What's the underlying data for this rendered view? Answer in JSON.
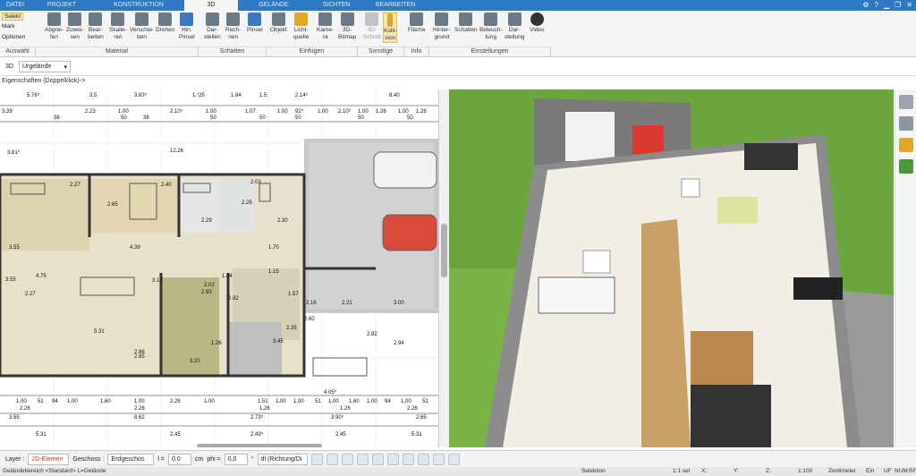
{
  "tabs": [
    "DATEI",
    "PROJEKT",
    "KONSTRUKTION",
    "3D",
    "GELÄNDE",
    "SICHTEN",
    "BEARBEITEN"
  ],
  "active_tab": "3D",
  "ribbon": {
    "selekt": "Selekt",
    "mark": "Mark",
    "optionen": "Optionen",
    "abgreifen": "Abgrei-\nfen",
    "zuweisen": "Zuwei-\nsen",
    "bearbeiten": "Bear-\nbeiten",
    "skalieren": "Skalie-\nren",
    "verschieben": "Verschie-\nben",
    "drehen": "Drehen",
    "hinpinsel": "Hin.\nPinsel",
    "darstellen": "Dar-\nstellen",
    "rechnen": "Rech-\nnen",
    "pinsel": "Pinsel",
    "objekt": "Objekt",
    "lichtquelle": "Licht-\nquelle",
    "kamera": "Kame-\nra",
    "bitmap3d": "3D-\nBitmap",
    "schnitt3d": "3D-\nSchnitt",
    "kollision": "Kolli-\nsion",
    "flaeche": "Fläche",
    "hintergrund": "Hinter-\ngrund",
    "schatten": "Schatten",
    "beleuchtung": "Beleuch-\ntung",
    "darstellung": "Dar-\nstellung",
    "video": "Video",
    "groups": {
      "auswahl": "Auswahl",
      "material": "Material",
      "schatten": "Schatten",
      "einfuegen": "Einfügen",
      "sonstige": "Sonstige",
      "info": "Info",
      "einstellungen": "Einstellungen"
    }
  },
  "subbar": {
    "label": "3D",
    "value": "Urgelände"
  },
  "hint": "Eigenschaften (Doppelklick)->",
  "plan": {
    "top_dims": [
      "5.76⁵",
      "3.5",
      "3.83⁵",
      "1.⁷25",
      "1.84",
      "1.5",
      "2.14⁵",
      "8.40"
    ],
    "sub_dims": [
      "3.39",
      "2.23",
      "1.00",
      "2.10⁵",
      "1.00",
      "1.07",
      "1.00",
      "92⁵",
      "1.00",
      "2.10⁵",
      "1.00",
      "1.26",
      "1.00",
      "1.26"
    ],
    "sub_dims2": [
      "38",
      "50",
      "38",
      "50",
      "50",
      "50",
      "50",
      "50"
    ],
    "left_dims": [
      "3.81⁵",
      "12.26",
      "3.55",
      "2.27",
      "3.55"
    ],
    "room_dims": [
      "2.27",
      "2.65",
      "2.40",
      "2.26",
      "2.29",
      "2.30",
      "2.03",
      "4.39",
      "1.70",
      "2.93",
      "2.92",
      "2.86",
      "3.20",
      "5.31",
      "2.02",
      "1.57",
      "2.35",
      "2.16",
      "2.21",
      "2.82",
      "1.84",
      "1.26",
      "2.60",
      "1.15",
      "2.85",
      "3.45",
      "2.94",
      "4.75",
      "3.19",
      "3.00"
    ],
    "bottom_row1": [
      "1.00",
      "51",
      "94",
      "1.00",
      "1.60",
      "1.00",
      "2.26",
      "1.00",
      "1.51",
      "1.00",
      "1.00",
      "51",
      "1.00",
      "1.60",
      "1.00",
      "4.05⁰",
      "94",
      "1.00",
      "51"
    ],
    "bottom_row2": [
      "2.26",
      "2.26",
      "1.26",
      "1.26",
      "2.26"
    ],
    "bottom_row3": [
      "3.55",
      "8.62",
      "2.73⁵",
      "3.90⁵",
      "2.65"
    ],
    "bottom_row4": [
      "5.31",
      "2.45",
      "2.43⁵",
      "2.45",
      "5.31"
    ]
  },
  "bottom": {
    "layer_label": "Layer :",
    "layer_value": "2D-Elemen",
    "geschoss_label": "Geschoss :",
    "geschoss_value": "Erdgeschos",
    "l_label": "l =",
    "l_value": "0,0",
    "l_unit": "cm",
    "phi_label": "phi =",
    "phi_value": "0,0",
    "phi_unit": "°",
    "dl_value": "dl (Richtung/Di"
  },
  "status": {
    "left": "Geländebereich <Standard> L=Gelände",
    "selektion": "Selektion",
    "sel": "1:1 sel",
    "x": "X:",
    "y": "Y:",
    "z": "Z:",
    "scale": "1:100",
    "units": "Zentimeter",
    "ein": "Ein",
    "uf": "UF",
    "num": "NUM",
    "rf": "RF"
  },
  "colors": {
    "ribbon_blue": "#2d7ac2",
    "selected": "#f6e6b6",
    "grass": "#6aa63b",
    "floor": "#e9e4d6",
    "wood": "#c8a068"
  }
}
